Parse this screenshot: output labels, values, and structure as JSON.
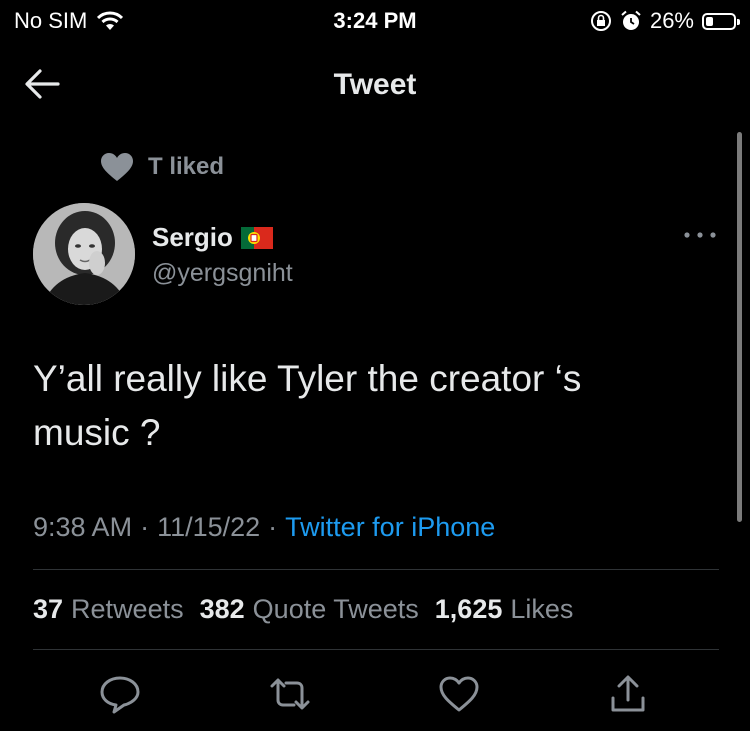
{
  "status_bar": {
    "carrier": "No SIM",
    "time": "3:24 PM",
    "battery": "26%",
    "battery_level": 0.26
  },
  "header": {
    "title": "Tweet"
  },
  "context": {
    "label": "T liked"
  },
  "author": {
    "name": "Sergio",
    "handle": "@yergsgniht"
  },
  "tweet": {
    "text_line1": "Y’all really like Tyler the creator ‘s",
    "text_line2": "music ?",
    "time": "9:38 AM",
    "date": "11/15/22",
    "source": "Twitter for iPhone"
  },
  "stats": {
    "retweets_count": "37",
    "retweets_label": "Retweets",
    "quotes_count": "382",
    "quotes_label": "Quote Tweets",
    "likes_count": "1,625",
    "likes_label": "Likes"
  },
  "colors": {
    "background": "#000000",
    "text": "#e7e9ea",
    "muted": "#8b9198",
    "link": "#1d9bf0",
    "divider": "#2f3336"
  },
  "icons": [
    "wifi-icon",
    "rotation-lock-icon",
    "alarm-icon",
    "battery-icon",
    "back-arrow-icon",
    "heart-icon",
    "portugal-flag-icon",
    "more-icon",
    "reply-icon",
    "retweet-icon",
    "like-icon",
    "share-icon"
  ]
}
